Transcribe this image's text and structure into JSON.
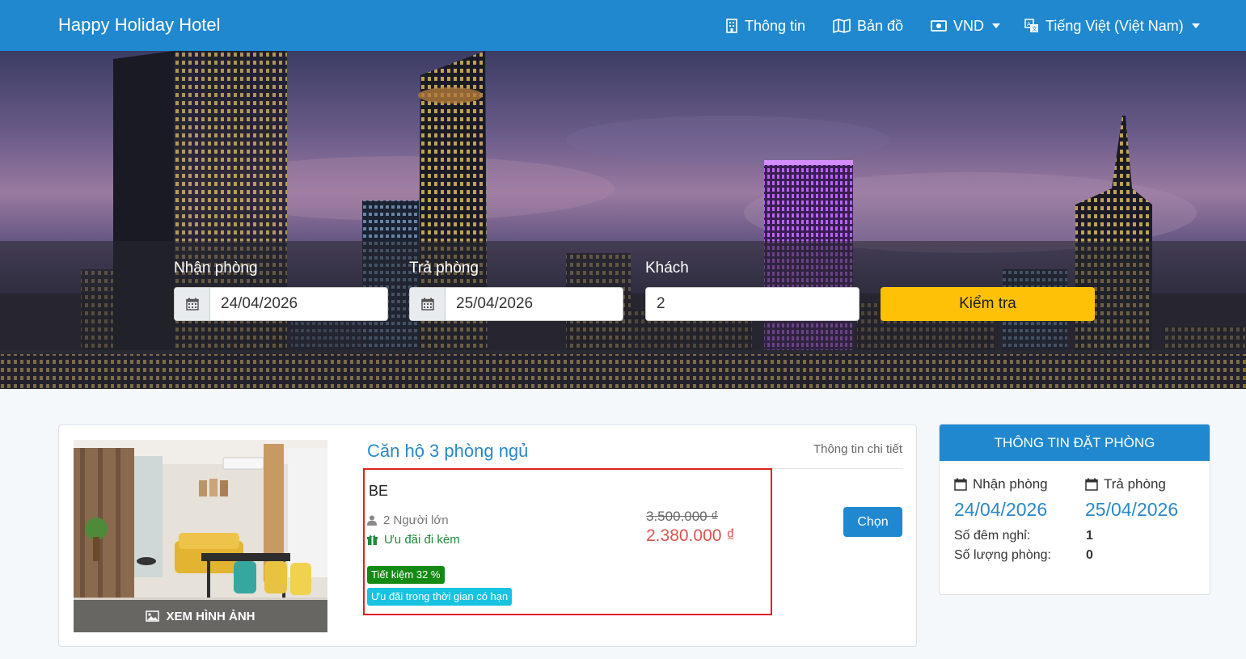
{
  "navbar": {
    "brand": "Happy Holiday Hotel",
    "info_label": "Thông tin",
    "map_label": "Bản đồ",
    "currency_label": "VND",
    "language_label": "Tiếng Việt (Việt Nam)"
  },
  "search": {
    "checkin_label": "Nhận phòng",
    "checkin_value": "24/04/2026",
    "checkout_label": "Trả phòng",
    "checkout_value": "25/04/2026",
    "guests_label": "Khách",
    "guests_value": "2",
    "check_button": "Kiểm tra"
  },
  "room": {
    "title": "Căn hộ 3 phòng ngủ",
    "detail_link": "Thông tin chi tiết",
    "view_photos": "XEM HÌNH ẢNH",
    "rate": {
      "name": "BE",
      "occupancy": "2 Người lớn",
      "perk": "Ưu đãi đi kèm",
      "old_price": "3.500.000 ₫",
      "new_price": "2.380.000 ₫",
      "badge_saving": "Tiết kiệm 32 %",
      "badge_limited": "Ưu đãi trong thời gian có hạn"
    },
    "choose_button": "Chọn"
  },
  "booking": {
    "title": "THÔNG TIN ĐẶT PHÒNG",
    "checkin_label": "Nhận phòng",
    "checkin_date": "24/04/2026",
    "checkout_label": "Trả phòng",
    "checkout_date": "25/04/2026",
    "nights_label": "Số đêm nghỉ:",
    "nights_value": "1",
    "rooms_label": "Số lượng phòng:",
    "rooms_value": "0"
  },
  "colors": {
    "primary": "#1f88cf",
    "accent": "#ffc107",
    "price_red": "#d9534f",
    "highlight_border": "#e0201f",
    "badge_green": "#148a14",
    "badge_cyan": "#17c3e0"
  },
  "icons": {
    "info": "building-icon",
    "map": "map-icon",
    "currency": "money-icon",
    "language": "translate-icon",
    "calendar": "calendar-icon",
    "user": "user-icon",
    "gift": "gift-icon",
    "image": "image-icon"
  }
}
